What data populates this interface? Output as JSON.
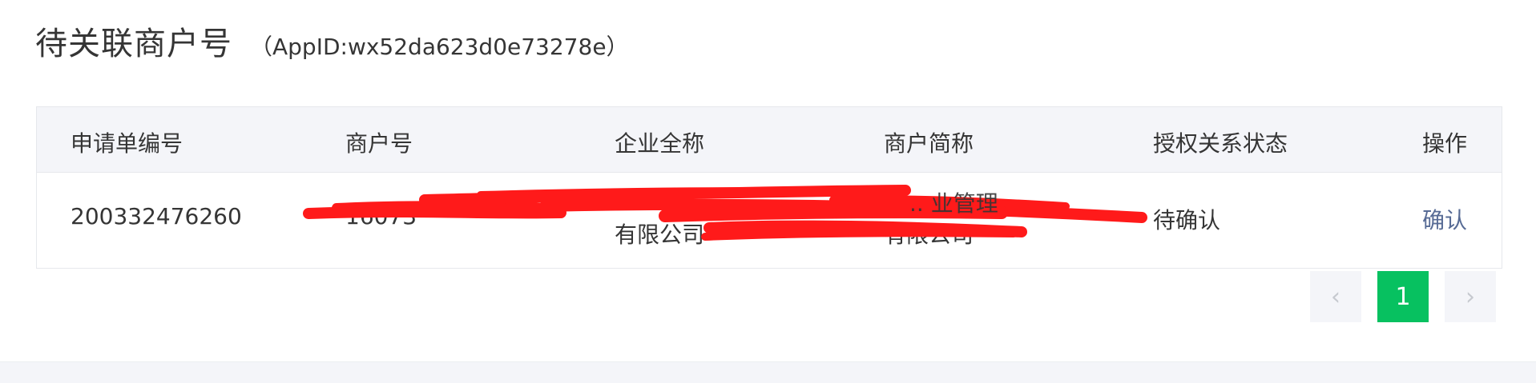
{
  "header": {
    "title": "待关联商户号",
    "app_id": "（AppID:wx52da623d0e73278e）"
  },
  "table": {
    "columns": [
      "申请单编号",
      "商户号",
      "企业全称",
      "商户简称",
      "授权关系状态",
      "操作"
    ],
    "rows": [
      {
        "application_id": "200332476260",
        "merchant_id": "16073",
        "company_full_name": "有限公司",
        "merchant_short_name": "有限公司",
        "status": "待确认",
        "action": "确认"
      }
    ]
  },
  "pagination": {
    "current_page": "1",
    "prev_icon": "chevron-left-icon",
    "next_icon": "chevron-right-icon",
    "accent": "#07c160"
  },
  "redaction_color": "#ff1a1a"
}
